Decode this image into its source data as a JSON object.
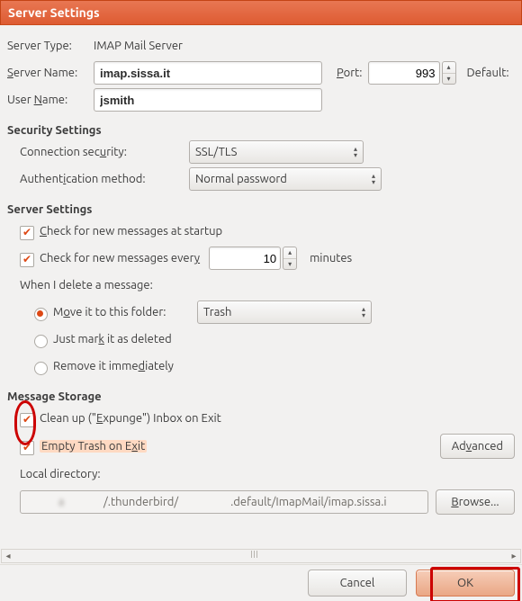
{
  "window": {
    "title": "Server Settings"
  },
  "server": {
    "type_label": "Server Type:",
    "type_value": "IMAP Mail Server",
    "name_label_pre": "S",
    "name_label_post": "erver Name:",
    "name_value": "imap.sissa.it",
    "port_label_pre": "P",
    "port_label_post": "ort:",
    "port_value": "993",
    "default_label": "Default:",
    "user_label_pre": "User ",
    "user_label_u": "N",
    "user_label_post": "ame:",
    "user_value": "jsmith"
  },
  "security": {
    "section": "Security Settings",
    "conn_label_pre": "Connection sec",
    "conn_label_u": "u",
    "conn_label_post": "rity:",
    "conn_value": "SSL/TLS",
    "auth_label_pre": "Authent",
    "auth_label_u": "i",
    "auth_label_post": "cation method:",
    "auth_value": "Normal password"
  },
  "settings": {
    "section": "Server Settings",
    "check_startup_pre": "C",
    "check_startup_post": "heck for new messages at startup",
    "check_every_pre": "Check for new messages ever",
    "check_every_u": "y",
    "check_every_value": "10",
    "check_every_unit": "minutes",
    "delete_label": "When I delete a message:",
    "move_pre": "M",
    "move_u": "o",
    "move_post": "ve it to this folder:",
    "trash_value": "Trash",
    "mark_pre": "Just mar",
    "mark_u": "k",
    "mark_post": " it as deleted",
    "remove_pre": "Remove it imme",
    "remove_u": "d",
    "remove_post": "iately"
  },
  "storage": {
    "section": "Message Storage",
    "cleanup_pre": "Clean up (\"",
    "cleanup_u": "E",
    "cleanup_post": "xpunge\") Inbox on Exit",
    "empty_pre": "Empty Trash on E",
    "empty_u": "x",
    "empty_post": "it",
    "advanced_pre": "Ad",
    "advanced_u": "v",
    "advanced_post": "anced",
    "localdir_label": "Local directory:",
    "localdir_value_a": "/.thunderbird/",
    "localdir_value_b": ".default/ImapMail/imap.sissa.i",
    "browse_u": "B",
    "browse_post": "rowse..."
  },
  "footer": {
    "cancel": "Cancel",
    "ok": "OK"
  }
}
